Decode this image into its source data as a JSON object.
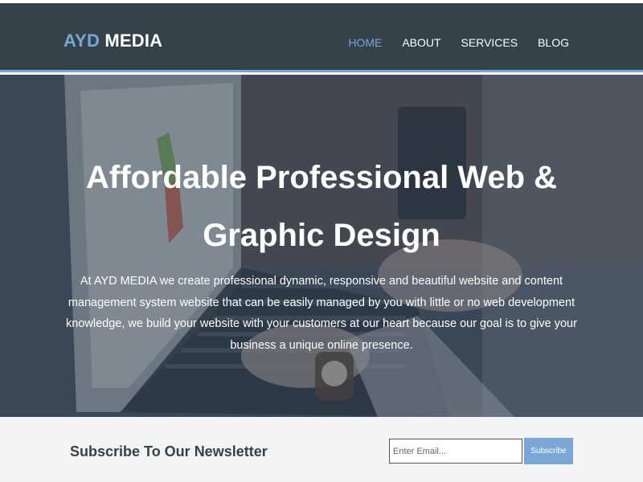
{
  "header": {
    "logo_accent": "AYD",
    "logo_rest": " MEDIA",
    "nav": [
      {
        "label": "HOME",
        "active": true
      },
      {
        "label": "ABOUT",
        "active": false
      },
      {
        "label": "SERVICES",
        "active": false
      },
      {
        "label": "BLOG",
        "active": false
      }
    ]
  },
  "hero": {
    "title_line1": "Affordable Professional Web &",
    "title_line2": "Graphic Design",
    "description": "At AYD MEDIA we create professional dynamic, responsive and beautiful website and content management system website that can be easily managed by you with little or no web development knowledge, we build your website with your customers at our heart because our goal is to give your business a unique online presence."
  },
  "newsletter": {
    "title": "Subscribe To Our Newsletter",
    "email_placeholder": "Enter Email...",
    "email_value": "",
    "button_label": "Subscribe"
  },
  "colors": {
    "header_bg": "#35424a",
    "accent": "#7aa7d6",
    "newsletter_bg": "#f4f4f4",
    "text_dark": "#35424a"
  }
}
